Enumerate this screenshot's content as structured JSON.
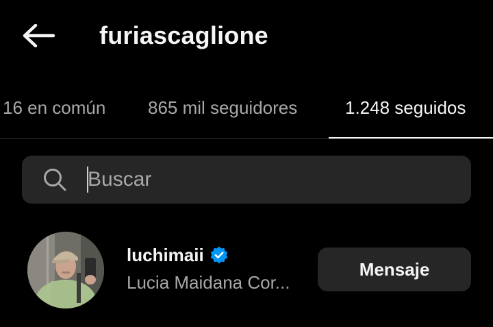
{
  "header": {
    "title": "furiascaglione",
    "back_icon": "arrow-left-icon"
  },
  "tabs": [
    {
      "label": "16 en común",
      "active": false
    },
    {
      "label": "865 mil seguidores",
      "active": false
    },
    {
      "label": "1.248 seguidos",
      "active": true
    }
  ],
  "search": {
    "placeholder": "Buscar",
    "value": "",
    "icon": "search-icon"
  },
  "users": [
    {
      "username": "luchimaii",
      "verified": true,
      "full_name": "Lucia Maidana Cor...",
      "button_label": "Mensaje"
    }
  ],
  "colors": {
    "background": "#000000",
    "text_primary": "#f5f5f5",
    "text_secondary": "#a8a8a8",
    "surface": "#262626",
    "verified_blue": "#0095f6",
    "divider": "#363636"
  }
}
